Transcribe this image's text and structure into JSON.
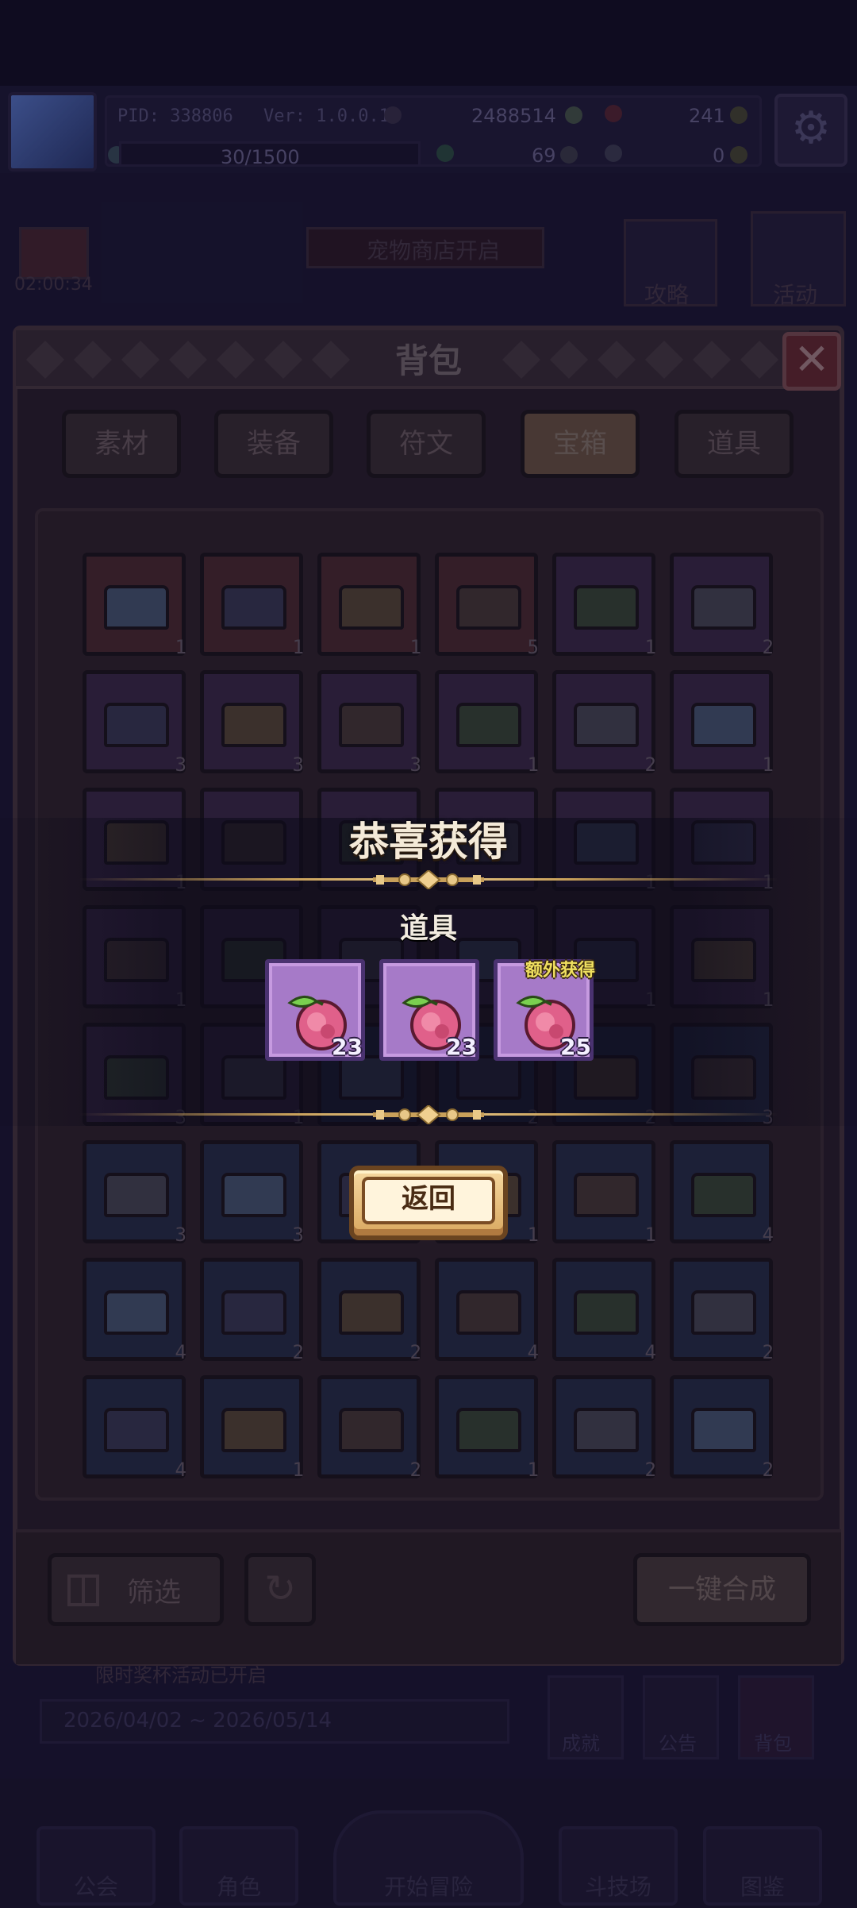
{
  "hud": {
    "pid": "PID: 338806",
    "version": "Ver: 1.0.0.10",
    "gold": "2488514",
    "gems": "241",
    "exp": "30/1500",
    "tickets": "69",
    "keys": "0"
  },
  "background": {
    "timer": "02:00:34",
    "shop_banner": "宠物商店开启",
    "guide_button": "攻略",
    "event_button": "活动",
    "event_notice": "限时奖杯活动已开启",
    "event_dates": "2026/04/02 ~ 2026/05/14",
    "achievement_button": "成就",
    "announcement_button": "公告",
    "backpack_button": "背包",
    "nav": [
      "公会",
      "角色",
      "开始冒险",
      "斗技场",
      "图鉴"
    ]
  },
  "panel": {
    "title": "背包",
    "tabs": [
      "素材",
      "装备",
      "符文",
      "宝箱",
      "道具"
    ],
    "active_tab": "宝箱",
    "filter_label": "筛选",
    "merge_label": "一键合成"
  },
  "grid": {
    "rows": [
      [
        {
          "c": "red",
          "n": "1"
        },
        {
          "c": "red",
          "n": "1"
        },
        {
          "c": "red",
          "n": "1"
        },
        {
          "c": "red",
          "n": "5"
        },
        {
          "c": "purple",
          "n": "1"
        },
        {
          "c": "purple",
          "n": "2"
        }
      ],
      [
        {
          "c": "purple",
          "n": "3"
        },
        {
          "c": "purple",
          "n": "3"
        },
        {
          "c": "purple",
          "n": "3"
        },
        {
          "c": "purple",
          "n": "1"
        },
        {
          "c": "purple",
          "n": "2"
        },
        {
          "c": "purple",
          "n": "1"
        }
      ],
      [
        {
          "c": "purple",
          "n": "1"
        },
        {
          "c": "purple",
          "n": ""
        },
        {
          "c": "purple",
          "n": ""
        },
        {
          "c": "purple",
          "n": ""
        },
        {
          "c": "purple",
          "n": "1"
        },
        {
          "c": "purple",
          "n": "1"
        }
      ],
      [
        {
          "c": "purple",
          "n": "1"
        },
        {
          "c": "purple",
          "n": ""
        },
        {
          "c": "purple",
          "n": ""
        },
        {
          "c": "purple",
          "n": ""
        },
        {
          "c": "purple",
          "n": "1"
        },
        {
          "c": "purple",
          "n": "1"
        }
      ],
      [
        {
          "c": "purple",
          "n": "3"
        },
        {
          "c": "purple",
          "n": "1"
        },
        {
          "c": "blue",
          "n": ""
        },
        {
          "c": "blue",
          "n": "2"
        },
        {
          "c": "blue",
          "n": "2"
        },
        {
          "c": "blue",
          "n": "3"
        }
      ],
      [
        {
          "c": "blue",
          "n": "3"
        },
        {
          "c": "blue",
          "n": "3"
        },
        {
          "c": "blue",
          "n": ""
        },
        {
          "c": "blue",
          "n": "1"
        },
        {
          "c": "blue",
          "n": "1"
        },
        {
          "c": "blue",
          "n": "4"
        }
      ],
      [
        {
          "c": "blue",
          "n": "4"
        },
        {
          "c": "blue",
          "n": "2"
        },
        {
          "c": "blue",
          "n": "2"
        },
        {
          "c": "blue",
          "n": "4"
        },
        {
          "c": "blue",
          "n": "4"
        },
        {
          "c": "blue",
          "n": "2"
        }
      ],
      [
        {
          "c": "blue",
          "n": "4"
        },
        {
          "c": "blue",
          "n": "1"
        },
        {
          "c": "blue",
          "n": "2"
        },
        {
          "c": "blue",
          "n": "1"
        },
        {
          "c": "blue",
          "n": "2"
        },
        {
          "c": "blue",
          "n": "2"
        }
      ]
    ]
  },
  "reward": {
    "title": "恭喜获得",
    "category": "道具",
    "items": [
      {
        "icon": "pink-fruit-icon",
        "count": "23"
      },
      {
        "icon": "pink-fruit-icon",
        "count": "23"
      },
      {
        "icon": "pink-fruit-icon",
        "count": "25"
      }
    ],
    "bonus_label": "额外获得",
    "return_label": "返回"
  }
}
